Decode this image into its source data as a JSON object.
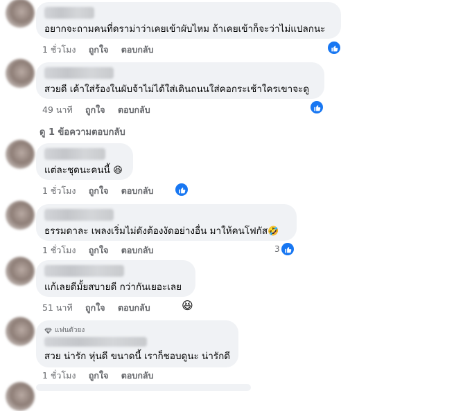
{
  "actions": {
    "like": "ถูกใจ",
    "reply": "ตอบกลับ"
  },
  "comments": [
    {
      "text": "อยากจะถามคนที่ดราม่าว่าเคยเข้าผับไหม ถ้าเคยเข้าก็จะว่าไม่แปลกนะ",
      "time": "1 ชั่วโมง",
      "reaction_count": ""
    },
    {
      "text": "สวยดี เค้าใส่ร้องในผับจ้าไม่ได้ใส่เดินถนนใส่คอกระเช้าใครเขาจะดู",
      "time": "49 นาที",
      "reaction_count": ""
    },
    {
      "text": "แต่ละชุดนะคนนี้",
      "emoji": "😆",
      "time": "1 ชั่วโมง",
      "reaction_count": ""
    },
    {
      "text": "ธรรมดาละ เพลงเริ่มไม่ดังต้องงัดอย่างอื่น มาให้คนโฟกัส",
      "emoji": "🤣",
      "time": "1 ชั่วโมง",
      "reaction_count": "3"
    },
    {
      "text": "แก้เลยดีมั้ยสบายดี กว่ากันเยอะเลย",
      "time": "51 นาที",
      "reaction_emoji": "😆"
    },
    {
      "text": "สวย น่ารัก หุ่นดี ขนาดนี้ เราก็ชอบดูนะ น่ารักดี",
      "time": "1 ชั่วโมง",
      "badge": "แฟนตัวยง"
    }
  ],
  "view_replies": "ดู 1 ข้อความตอบกลับ",
  "colors": {
    "like_blue": "#1877f2",
    "bubble_bg": "#f0f2f5",
    "meta_gray": "#65676b"
  }
}
